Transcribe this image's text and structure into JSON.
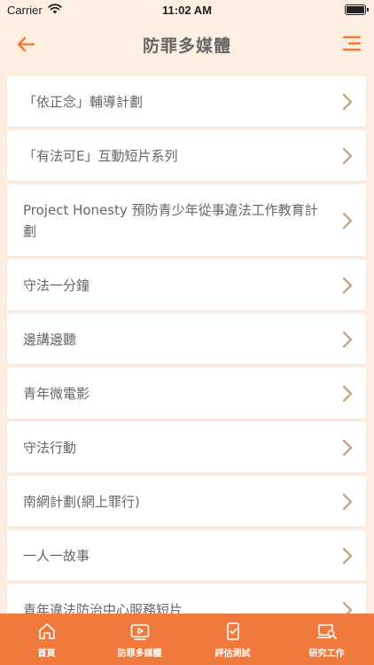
{
  "status": {
    "carrier": "Carrier",
    "time": "11:02 AM"
  },
  "header": {
    "title": "防罪多媒體"
  },
  "colors": {
    "accent": "#f07a3d",
    "background": "#fcefe2",
    "chevron": "#c8a587"
  },
  "items": [
    {
      "label": "「依正念」輔導計劃"
    },
    {
      "label": "「有法可E」互動短片系列"
    },
    {
      "label": "Project Honesty 預防青少年從事違法工作教育計劃"
    },
    {
      "label": "守法一分鐘"
    },
    {
      "label": "邊講邊聽"
    },
    {
      "label": "青年微電影"
    },
    {
      "label": "守法行動"
    },
    {
      "label": "南網計劃(網上罪行)"
    },
    {
      "label": "一人一故事"
    },
    {
      "label": "青年違法防治中心服務短片"
    }
  ],
  "tabs": [
    {
      "label": "首頁",
      "icon": "home-icon"
    },
    {
      "label": "防罪多媒體",
      "icon": "video-icon"
    },
    {
      "label": "評估測試",
      "icon": "assessment-icon"
    },
    {
      "label": "研究工作",
      "icon": "research-icon"
    }
  ]
}
